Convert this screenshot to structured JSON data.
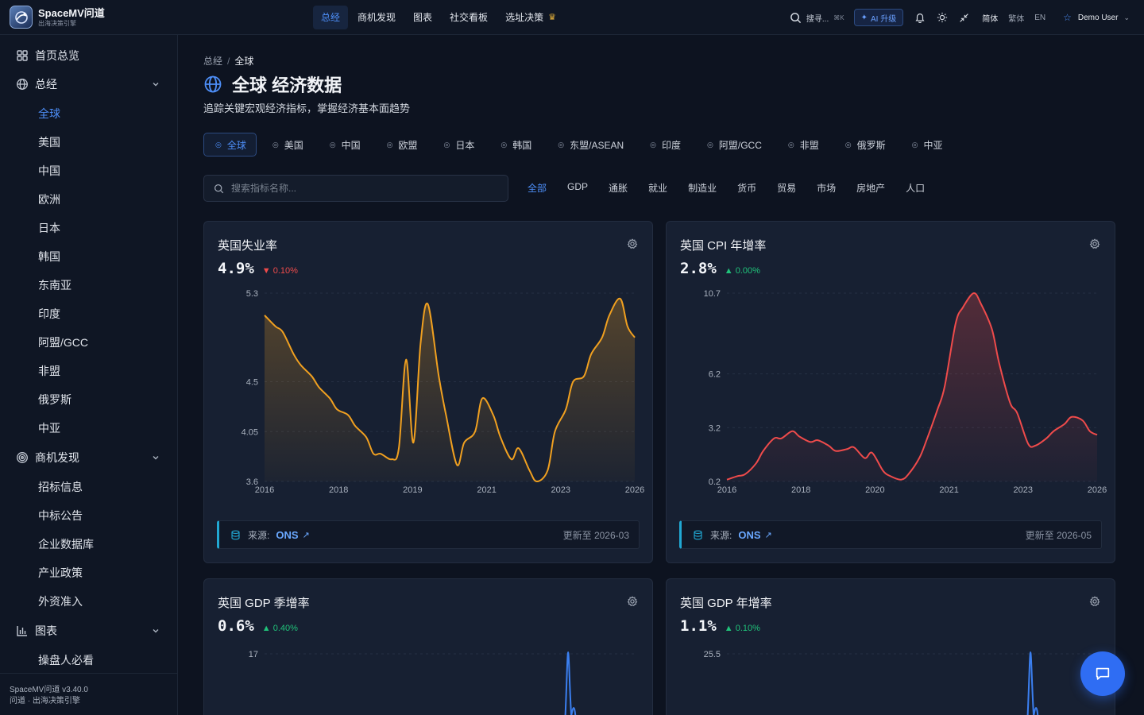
{
  "brand": {
    "name": "SpaceMV问道",
    "tagline": "出海决策引擎"
  },
  "topnav": [
    {
      "label": "总经",
      "active": true
    },
    {
      "label": "商机发现"
    },
    {
      "label": "图表"
    },
    {
      "label": "社交看板"
    },
    {
      "label": "选址决策",
      "icon": "crown-icon"
    }
  ],
  "topbar": {
    "search_label": "搜寻...",
    "search_shortcut": "⌘K",
    "ai_label": "AI 升级",
    "langs": [
      "简体",
      "繁体",
      "EN"
    ],
    "user": "Demo User"
  },
  "sidebar": {
    "items": [
      {
        "label": "首页总览",
        "icon": "grid-icon"
      },
      {
        "label": "总经",
        "icon": "globe-icon",
        "expandable": true
      },
      {
        "label": "全球",
        "sub": true,
        "active": true
      },
      {
        "label": "美国",
        "sub": true
      },
      {
        "label": "中国",
        "sub": true
      },
      {
        "label": "欧洲",
        "sub": true
      },
      {
        "label": "日本",
        "sub": true
      },
      {
        "label": "韩国",
        "sub": true
      },
      {
        "label": "东南亚",
        "sub": true
      },
      {
        "label": "印度",
        "sub": true
      },
      {
        "label": "阿盟/GCC",
        "sub": true
      },
      {
        "label": "非盟",
        "sub": true
      },
      {
        "label": "俄罗斯",
        "sub": true
      },
      {
        "label": "中亚",
        "sub": true
      },
      {
        "label": "商机发现",
        "icon": "target-icon",
        "expandable": true
      },
      {
        "label": "招标信息",
        "sub": true
      },
      {
        "label": "中标公告",
        "sub": true
      },
      {
        "label": "企业数据库",
        "sub": true
      },
      {
        "label": "产业政策",
        "sub": true
      },
      {
        "label": "外资准入",
        "sub": true
      },
      {
        "label": "图表",
        "icon": "bar-chart-icon",
        "expandable": true
      },
      {
        "label": "操盘人必看",
        "sub": true
      }
    ],
    "footer_version": "SpaceMV问道 v3.40.0",
    "footer_tagline": "问道 · 出海决策引擎"
  },
  "page": {
    "breadcrumb_root": "总经",
    "breadcrumb_sep": "/",
    "breadcrumb_current": "全球",
    "title": "全球 经济数据",
    "subtitle": "追踪关键宏观经济指标，掌握经济基本面趋势",
    "search_placeholder": "搜索指标名称..."
  },
  "region_tabs": [
    "全球",
    "美国",
    "中国",
    "欧盟",
    "日本",
    "韩国",
    "东盟/ASEAN",
    "印度",
    "阿盟/GCC",
    "非盟",
    "俄罗斯",
    "中亚"
  ],
  "category_tabs": [
    "全部",
    "GDP",
    "通胀",
    "就业",
    "制造业",
    "货币",
    "贸易",
    "市场",
    "房地产",
    "人口"
  ],
  "colors": {
    "accent": "#4d8ef7",
    "orange": "#f0a020",
    "red": "#ef4b4b",
    "blue": "#3b7ff0",
    "green": "#20c27a"
  },
  "cards": [
    {
      "title": "英国失业率",
      "value": "4.9%",
      "change": "0.10%",
      "direction": "down",
      "source_label": "来源:",
      "source": "ONS",
      "updated": "更新至 2026-03"
    },
    {
      "title": "英国 CPI 年增率",
      "value": "2.8%",
      "change": "0.00%",
      "direction": "up",
      "source_label": "来源:",
      "source": "ONS",
      "updated": "更新至 2026-05"
    },
    {
      "title": "英国 GDP 季增率",
      "value": "0.6%",
      "change": "0.40%",
      "direction": "up"
    },
    {
      "title": "英国 GDP 年增率",
      "value": "1.1%",
      "change": "0.10%",
      "direction": "up"
    }
  ],
  "chart_data": [
    {
      "type": "area",
      "title": "英国失业率",
      "color": "#f0a020",
      "y_ticks": [
        3.6,
        4.05,
        4.5,
        5.3
      ],
      "ylim": [
        3.6,
        5.3
      ],
      "x_ticks": [
        "2016",
        "2018",
        "2019",
        "2021",
        "2023",
        "2026"
      ],
      "x": [
        2016.0,
        2016.3,
        2016.5,
        2016.8,
        2017.0,
        2017.3,
        2017.5,
        2017.8,
        2018.0,
        2018.3,
        2018.5,
        2018.8,
        2019.0,
        2019.2,
        2019.5,
        2019.7,
        2019.9,
        2020.1,
        2020.3,
        2020.5,
        2020.8,
        2021.0,
        2021.3,
        2021.5,
        2021.8,
        2022.0,
        2022.3,
        2022.5,
        2022.8,
        2023.0,
        2023.3,
        2023.5,
        2023.8,
        2024.0,
        2024.3,
        2024.5,
        2024.8,
        2025.0,
        2025.3,
        2025.5,
        2025.8,
        2026.0,
        2026.2
      ],
      "values": [
        5.1,
        5.0,
        4.95,
        4.75,
        4.65,
        4.55,
        4.45,
        4.35,
        4.25,
        4.2,
        4.1,
        4.0,
        3.85,
        3.85,
        3.8,
        3.9,
        4.7,
        3.95,
        4.85,
        5.2,
        4.55,
        4.2,
        3.75,
        3.95,
        4.05,
        4.35,
        4.2,
        4.0,
        3.8,
        3.9,
        3.7,
        3.6,
        3.7,
        4.05,
        4.25,
        4.5,
        4.55,
        4.75,
        4.9,
        5.1,
        5.25,
        5.0,
        4.9
      ]
    },
    {
      "type": "area",
      "title": "英国 CPI 年增率",
      "color": "#ef4b4b",
      "y_ticks": [
        0.2,
        3.2,
        6.2,
        10.7
      ],
      "ylim": [
        0.2,
        10.7
      ],
      "x_ticks": [
        "2016",
        "2018",
        "2020",
        "2021",
        "2023",
        "2026"
      ],
      "x": [
        2016.0,
        2016.3,
        2016.5,
        2016.8,
        2017.0,
        2017.3,
        2017.5,
        2017.8,
        2018.0,
        2018.3,
        2018.5,
        2018.8,
        2019.0,
        2019.3,
        2019.5,
        2019.8,
        2020.0,
        2020.3,
        2020.5,
        2020.8,
        2021.0,
        2021.3,
        2021.5,
        2021.8,
        2022.0,
        2022.3,
        2022.5,
        2022.8,
        2023.0,
        2023.3,
        2023.5,
        2023.8,
        2024.0,
        2024.3,
        2024.5,
        2024.8,
        2025.0,
        2025.3,
        2025.5,
        2025.8,
        2026.0,
        2026.2
      ],
      "values": [
        0.3,
        0.5,
        0.6,
        1.2,
        1.9,
        2.6,
        2.6,
        3.0,
        2.7,
        2.4,
        2.5,
        2.2,
        1.9,
        2.0,
        2.1,
        1.5,
        1.8,
        0.8,
        0.5,
        0.3,
        0.6,
        1.5,
        2.5,
        4.2,
        5.5,
        9.0,
        9.9,
        10.7,
        10.1,
        8.7,
        6.8,
        4.6,
        4.0,
        2.3,
        2.2,
        2.6,
        3.0,
        3.4,
        3.8,
        3.6,
        3.0,
        2.8
      ]
    },
    {
      "type": "line",
      "title": "英国 GDP 季增率",
      "color": "#3b7ff0",
      "y_ticks": [
        17
      ]
    },
    {
      "type": "line",
      "title": "英国 GDP 年增率",
      "color": "#3b7ff0",
      "y_ticks": [
        25.5
      ]
    }
  ]
}
